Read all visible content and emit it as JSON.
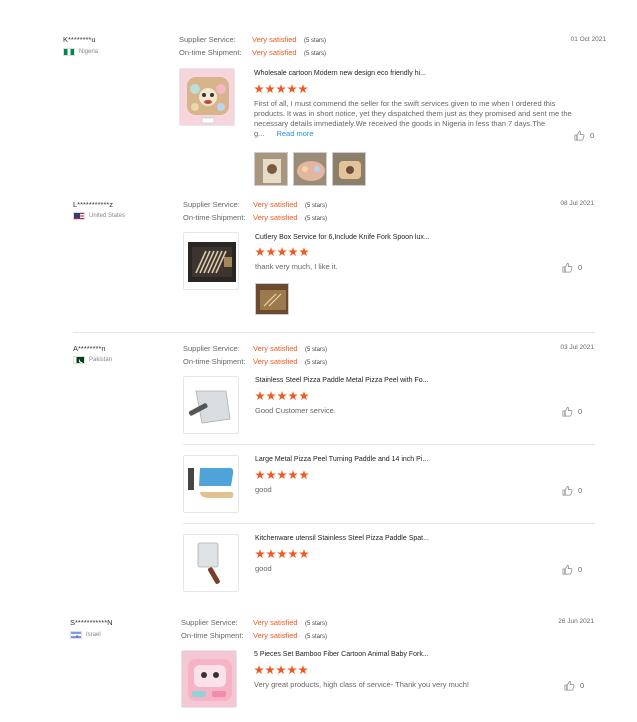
{
  "labels": {
    "supplier_service": "Supplier Service:",
    "on_time_shipment": "On-time Shipment:",
    "read_more": "Read more"
  },
  "reviews": [
    {
      "reviewer": "K********u",
      "country": "Nigeria",
      "date": "01 Oct 2021",
      "supplier_service": "Very satisfied",
      "supplier_service_stars": "(5 stars)",
      "on_time_shipment": "Very satisfied",
      "on_time_shipment_stars": "(5 stars)",
      "products": [
        {
          "title": "Wholesale cartoon Modern new design eco friendly hi...",
          "rating": 5,
          "comment": "First of all, I must commend the seller for the swift services given to me when I ordered this products. It was in short notice, yet they dispatched them just as they promised and sent me the necessary details immediately.We received the goods in Nigeria in less than 7 days.The g...",
          "likes": "0",
          "thumb_icon": "baby-plate-icon"
        }
      ]
    },
    {
      "reviewer": "L***********z",
      "country": "United States",
      "date": "08 Jul 2021",
      "supplier_service": "Very satisfied",
      "supplier_service_stars": "(5 stars)",
      "on_time_shipment": "Very satisfied",
      "on_time_shipment_stars": "(5 stars)",
      "products": [
        {
          "title": "Cutlery Box Service for 6,Include Knife Fork Spoon lux...",
          "rating": 5,
          "comment": "thank very much, I like it.",
          "likes": "0",
          "thumb_icon": "cutlery-box-icon"
        }
      ]
    },
    {
      "reviewer": "A********n",
      "country": "Pakistan",
      "date": "03 Jul 2021",
      "supplier_service": "Very satisfied",
      "supplier_service_stars": "(5 stars)",
      "on_time_shipment": "Very satisfied",
      "on_time_shipment_stars": "(5 stars)",
      "products": [
        {
          "title": "Stainless Steel Pizza Paddle Metal Pizza Peel with Fo...",
          "rating": 5,
          "comment": "Good Customer service.",
          "likes": "0",
          "thumb_icon": "pizza-peel-icon"
        },
        {
          "title": "Large Metal Pizza Peel Turning Paddle and 14 inch Pi...",
          "rating": 5,
          "comment": "good",
          "likes": "0",
          "thumb_icon": "pizza-paddle-set-icon"
        },
        {
          "title": "Kitchenware utensil Stainless Steel Pizza Paddle Spat...",
          "rating": 5,
          "comment": "good",
          "likes": "0",
          "thumb_icon": "pizza-spatula-icon"
        }
      ]
    },
    {
      "reviewer": "S***********N",
      "country": "Israel",
      "date": "26 Jun 2021",
      "supplier_service": "Very satisfied",
      "supplier_service_stars": "(5 stars)",
      "on_time_shipment": "Very satisfied",
      "on_time_shipment_stars": "(5 stars)",
      "products": [
        {
          "title": "5 Pieces Set Bamboo Fiber Cartoon Animal Baby Fork...",
          "rating": 5,
          "comment": "Very great products, high class of service- Thank you very much!",
          "likes": "0",
          "thumb_icon": "bamboo-baby-set-icon"
        }
      ]
    }
  ],
  "colors": {
    "accent": "#f05a22",
    "link": "#2b8ce6"
  }
}
